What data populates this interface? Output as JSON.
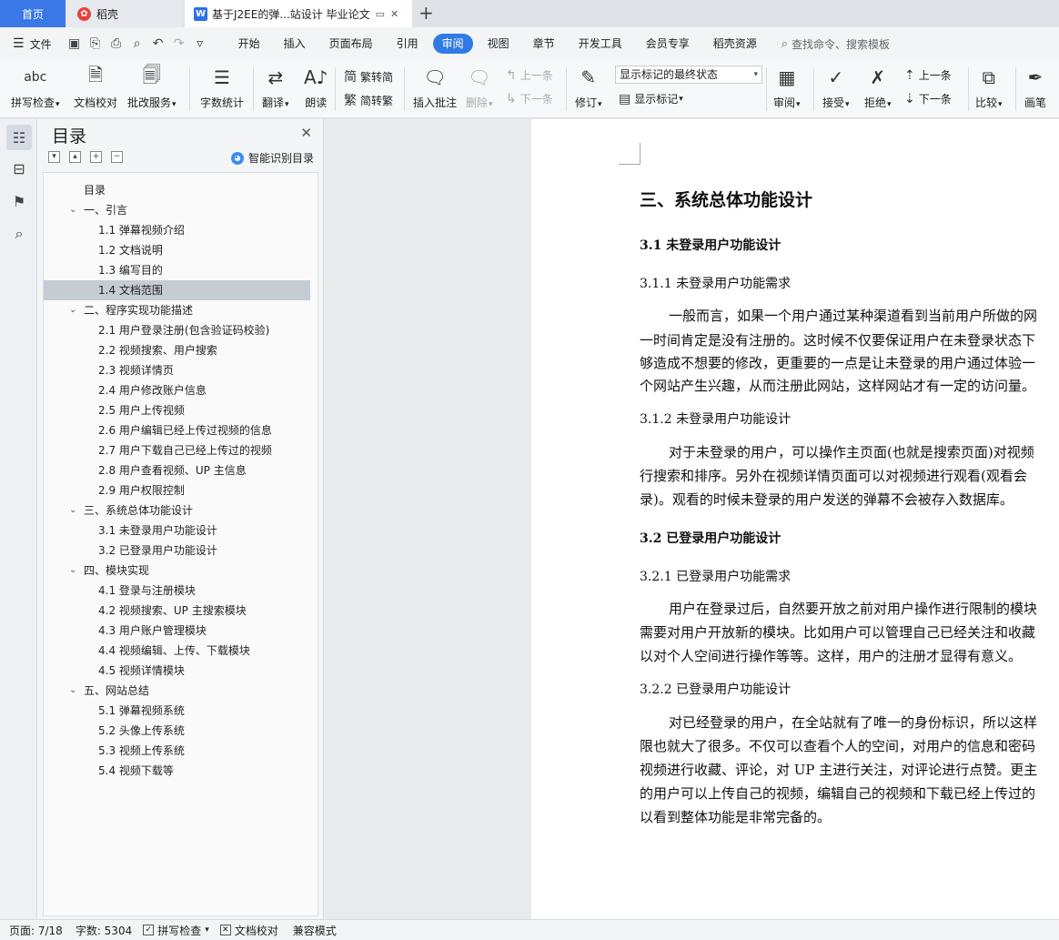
{
  "tabs": {
    "home": "首页",
    "daoke": "稻壳",
    "doc_title": "基于J2EE的弹...站设计 毕业论文"
  },
  "menu": {
    "file": "文件",
    "tabs": [
      "开始",
      "插入",
      "页面布局",
      "引用",
      "审阅",
      "视图",
      "章节",
      "开发工具",
      "会员专享",
      "稻壳资源"
    ],
    "active_tab": "审阅",
    "search_placeholder": "查找命令、搜索模板"
  },
  "ribbon": {
    "spell_check": "拼写检查",
    "doc_check": "文档校对",
    "review_service": "批改服务",
    "word_count": "字数统计",
    "translate": "翻译",
    "read_aloud": "朗读",
    "trad_to_simp": "繁转简",
    "simp_to_trad": "简转繁",
    "insert_comment": "插入批注",
    "delete": "删除",
    "prev_comment": "上一条",
    "next_comment": "下一条",
    "track_changes": "修订",
    "markup_mode": "显示标记的最终状态",
    "show_markup": "显示标记",
    "review": "审阅",
    "accept": "接受",
    "reject": "拒绝",
    "prev_change": "上一条",
    "next_change": "下一条",
    "compare": "比较",
    "pen": "画笔",
    "icon_abc": "abc"
  },
  "toc": {
    "title": "目录",
    "smart": "智能识别目录",
    "items": [
      {
        "text": "目录",
        "level": 0
      },
      {
        "text": "一、引言",
        "level": 1
      },
      {
        "text": "1.1 弹幕视频介绍",
        "level": 2
      },
      {
        "text": "1.2 文档说明",
        "level": 2
      },
      {
        "text": "1.3 编写目的",
        "level": 2
      },
      {
        "text": "1.4 文档范围",
        "level": 2,
        "selected": true
      },
      {
        "text": "二、程序实现功能描述",
        "level": 1
      },
      {
        "text": "2.1 用户登录注册(包含验证码校验)",
        "level": 2
      },
      {
        "text": "2.2 视频搜索、用户搜索",
        "level": 2
      },
      {
        "text": "2.3 视频详情页",
        "level": 2
      },
      {
        "text": "2.4 用户修改账户信息",
        "level": 2
      },
      {
        "text": "2.5 用户上传视频",
        "level": 2
      },
      {
        "text": "2.6 用户编辑已经上传过视频的信息",
        "level": 2
      },
      {
        "text": "2.7 用户下载自己已经上传过的视频",
        "level": 2
      },
      {
        "text": "2.8 用户查看视频、UP 主信息",
        "level": 2
      },
      {
        "text": "2.9 用户权限控制",
        "level": 2
      },
      {
        "text": "三、系统总体功能设计",
        "level": 1
      },
      {
        "text": "3.1 未登录用户功能设计",
        "level": 2
      },
      {
        "text": "3.2 已登录用户功能设计",
        "level": 2
      },
      {
        "text": "四、模块实现",
        "level": 1
      },
      {
        "text": "4.1 登录与注册模块",
        "level": 2
      },
      {
        "text": "4.2 视频搜索、UP 主搜索模块",
        "level": 2
      },
      {
        "text": "4.3 用户账户管理模块",
        "level": 2
      },
      {
        "text": "4.4 视频编辑、上传、下载模块",
        "level": 2
      },
      {
        "text": "4.5 视频详情模块",
        "level": 2
      },
      {
        "text": "五、网站总结",
        "level": 1
      },
      {
        "text": "5.1 弹幕视频系统",
        "level": 2
      },
      {
        "text": "5.2 头像上传系统",
        "level": 2
      },
      {
        "text": "5.3 视频上传系统",
        "level": 2
      },
      {
        "text": "5.4 视频下载等",
        "level": 2
      }
    ]
  },
  "document": {
    "lines": [
      {
        "text": "三、系统总体功能设计",
        "style": "h1"
      },
      {
        "text": "3.1 未登录用户功能设计",
        "style": "h2"
      },
      {
        "text": "3.1.1 未登录用户功能需求",
        "style": "h3"
      },
      {
        "text": "一般而言，如果一个用户通过某种渠道看到当前用户所做的网",
        "style": "p",
        "indent": true
      },
      {
        "text": "一时间肯定是没有注册的。这时候不仅要保证用户在未登录状态下",
        "style": "p"
      },
      {
        "text": "够造成不想要的修改，更重要的一点是让未登录的用户通过体验一",
        "style": "p"
      },
      {
        "text": "个网站产生兴趣，从而注册此网站，这样网站才有一定的访问量。",
        "style": "p"
      },
      {
        "text": "3.1.2 未登录用户功能设计",
        "style": "h3"
      },
      {
        "text": "对于未登录的用户，可以操作主页面(也就是搜索页面)对视频",
        "style": "p",
        "indent": true
      },
      {
        "text": "行搜索和排序。另外在视频详情页面可以对视频进行观看(观看会",
        "style": "p"
      },
      {
        "text": "录)。观看的时候未登录的用户发送的弹幕不会被存入数据库。",
        "style": "p"
      },
      {
        "text": "3.2 已登录用户功能设计",
        "style": "h2"
      },
      {
        "text": "3.2.1 已登录用户功能需求",
        "style": "h3"
      },
      {
        "text": "用户在登录过后，自然要开放之前对用户操作进行限制的模块",
        "style": "p",
        "indent": true
      },
      {
        "text": "需要对用户开放新的模块。比如用户可以管理自己已经关注和收藏",
        "style": "p"
      },
      {
        "text": "以对个人空间进行操作等等。这样，用户的注册才显得有意义。",
        "style": "p"
      },
      {
        "text": "3.2.2 已登录用户功能设计",
        "style": "h3"
      },
      {
        "text": "对已经登录的用户，在全站就有了唯一的身份标识，所以这样",
        "style": "p",
        "indent": true
      },
      {
        "text": "限也就大了很多。不仅可以查看个人的空间，对用户的信息和密码",
        "style": "p"
      },
      {
        "text": "视频进行收藏、评论，对 UP 主进行关注，对评论进行点赞。更主",
        "style": "p"
      },
      {
        "text": "的用户可以上传自己的视频，编辑自己的视频和下载已经上传过的",
        "style": "p"
      },
      {
        "text": "以看到整体功能是非常完备的。",
        "style": "p"
      }
    ]
  },
  "status": {
    "page": "页面: 7/18",
    "words": "字数: 5304",
    "spell": "拼写检查",
    "doc_check": "文档校对",
    "compat": "兼容模式"
  }
}
